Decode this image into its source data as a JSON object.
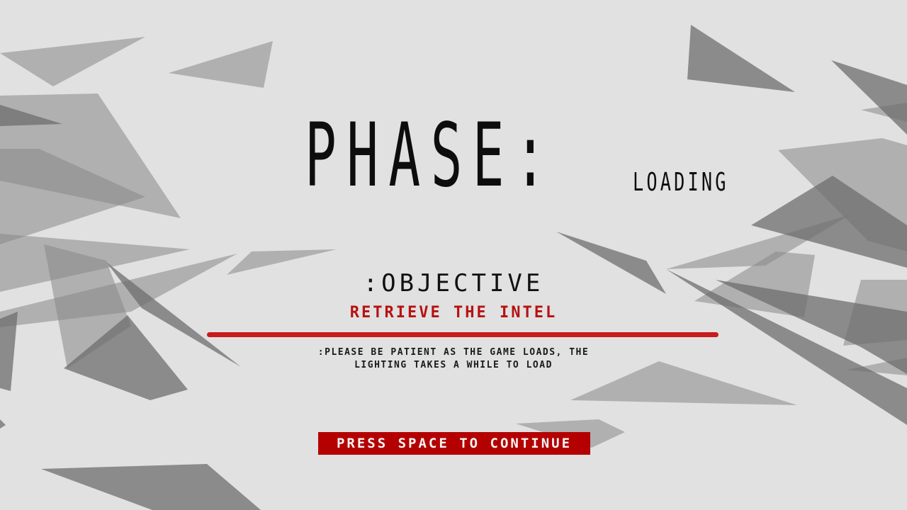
{
  "header": {
    "title": "PHASE:",
    "subtitle": "LOADING"
  },
  "objective": {
    "label": ":OBJECTIVE",
    "text": "RETRIEVE THE INTEL"
  },
  "note": {
    "line1": ":PLEASE BE PATIENT AS THE GAME LOADS, THE",
    "line2": "LIGHTING TAKES A WHILE TO LOAD"
  },
  "continue_button": {
    "label": "PRESS SPACE TO CONTINUE"
  },
  "colors": {
    "background": "#e1e1e1",
    "accent": "#b40000",
    "shard_light": "#b0b0b0",
    "shard_dark": "#878787"
  }
}
